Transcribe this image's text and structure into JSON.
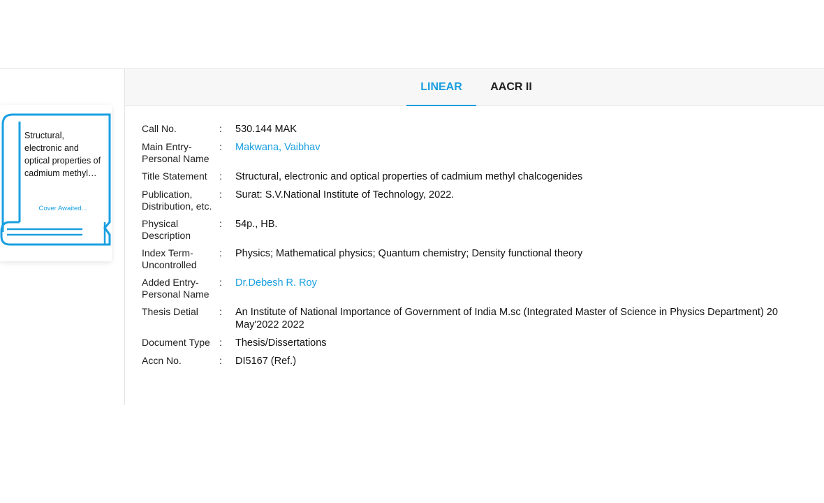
{
  "tabs": {
    "linear": "LINEAR",
    "aacr": "AACR II"
  },
  "cover": {
    "title": "Structural, electronic and optical properties of cadmium methyl…",
    "awaited": "Cover Awaited..."
  },
  "record": {
    "call_no": {
      "label": "Call No.",
      "value": "530.144 MAK"
    },
    "main_entry": {
      "label": "Main Entry-Personal Name",
      "value": "Makwana, Vaibhav"
    },
    "title_statement": {
      "label": "Title Statement",
      "value": "Structural, electronic and optical properties of cadmium methyl chalcogenides"
    },
    "publication": {
      "label": "Publication, Distribution, etc.",
      "value": "Surat: S.V.National Institute of Technology, 2022."
    },
    "physical": {
      "label": "Physical Description",
      "value": "54p., HB."
    },
    "index_term": {
      "label": "Index Term-Uncontrolled",
      "value": "Physics; Mathematical physics; Quantum chemistry; Density functional theory"
    },
    "added_entry": {
      "label": "Added Entry-Personal Name",
      "value": "Dr.Debesh R. Roy"
    },
    "thesis": {
      "label": "Thesis Detial",
      "value": "An Institute of National Importance of Government of India M.sc (Integrated Master of Science in Physics Department) 20 May'2022 2022"
    },
    "doc_type": {
      "label": "Document Type",
      "value": "Thesis/Dissertations"
    },
    "accn": {
      "label": "Accn No.",
      "value": "DI5167 (Ref.)"
    }
  },
  "colors": {
    "accent": "#1a9fe0"
  },
  "icons": {
    "cover": "book-icon"
  }
}
